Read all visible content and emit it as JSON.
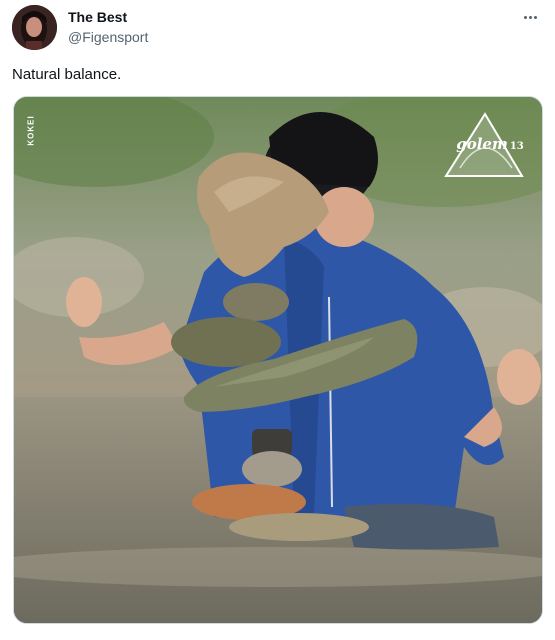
{
  "author": {
    "display_name": "The Best",
    "handle": "@Figensport"
  },
  "tweet": {
    "text": "Natural balance."
  },
  "media": {
    "side_watermark": "KOKEI",
    "logo_text": "golem",
    "logo_subtext": "13"
  },
  "icons": {
    "more": "more-horizontal-icon"
  },
  "colors": {
    "text_primary": "#0f1419",
    "text_secondary": "#536471",
    "jacket_blue": "#2f57a8",
    "water": "#8a8877"
  }
}
